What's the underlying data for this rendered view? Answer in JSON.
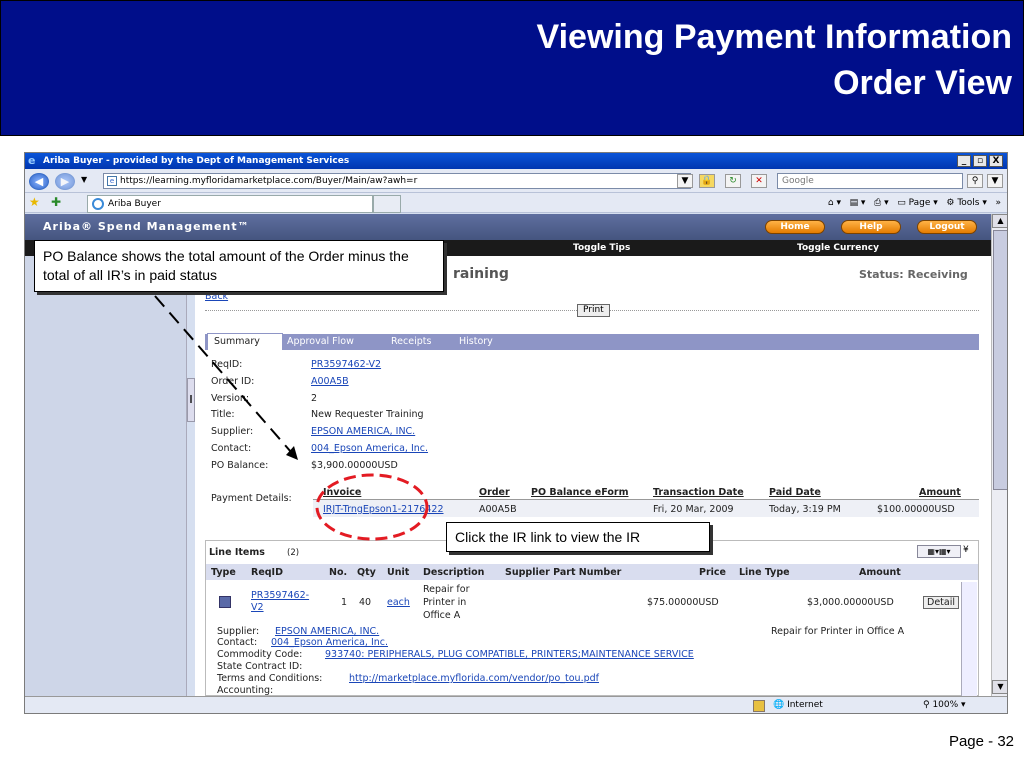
{
  "slide": {
    "title_line1": "Viewing Payment Information",
    "title_line2": "Order View",
    "page": "Page - 32"
  },
  "browser": {
    "window_title": "Ariba Buyer - provided by the Dept of Management Services",
    "window_min": "_",
    "window_max": "»",
    "window_close": "X",
    "url": "https://learning.myfloridamarketplace.com/Buyer/Main/aw?awh=r",
    "search_placeholder": "Google",
    "tab_title": "Ariba Buyer",
    "commands": {
      "page": "Page",
      "tools": "Tools"
    },
    "status_zone": "Internet",
    "zoom": "100%"
  },
  "ariba": {
    "brand": "Ariba® Spend Management™",
    "home": "Home",
    "help": "Help",
    "logout": "Logout",
    "toggle_tips": "Toggle Tips",
    "toggle_currency": "Toggle Currency",
    "page_title_fragment": "raining",
    "status": "Status: Receiving",
    "back": "Back",
    "print": "Print",
    "tabs": [
      "Summary",
      "Approval Flow",
      "Receipts",
      "History"
    ],
    "details": [
      {
        "label": "ReqID:",
        "value": "PR3597462-V2",
        "link": true
      },
      {
        "label": "Order ID:",
        "value": "A00A5B",
        "link": true
      },
      {
        "label": "Version:",
        "value": "2",
        "link": false
      },
      {
        "label": "Title:",
        "value": "New Requester Training",
        "link": false
      },
      {
        "label": "Supplier:",
        "value": "EPSON AMERICA, INC.",
        "link": true
      },
      {
        "label": "Contact:",
        "value": "004_Epson America, Inc.",
        "link": true
      },
      {
        "label": "PO Balance:",
        "value": "$3,900.00000USD",
        "link": false
      }
    ],
    "payment": {
      "label": "Payment Details:",
      "headers": [
        "Invoice",
        "Order",
        "PO Balance eForm",
        "Transaction Date",
        "Paid Date",
        "Amount"
      ],
      "row": [
        "IRJT-TrngEpson1-2176422",
        "A00A5B",
        "",
        "Fri, 20 Mar, 2009",
        "Today, 3:19 PM",
        "$100.00000USD"
      ]
    },
    "line_items": {
      "title": "Line Items",
      "count": "(2)",
      "headers": [
        "Type",
        "ReqID",
        "No.",
        "Qty",
        "Unit",
        "Description",
        "Supplier Part Number",
        "Price",
        "Line Type",
        "Amount"
      ],
      "row": {
        "reqid_1": "PR3597462-",
        "reqid_2": "V2",
        "no": "1",
        "qty": "40",
        "unit": "each",
        "desc_1": "Repair for",
        "desc_2": "Printer in",
        "desc_3": "Office A",
        "price": "$75.00000USD",
        "amount": "$3,000.00000USD",
        "detail": "Detail"
      },
      "extra": {
        "supplier_label": "Supplier:",
        "supplier": "EPSON AMERICA, INC.",
        "contact_label": "Contact:",
        "contact": "004_Epson America, Inc.",
        "commodity_label": "Commodity Code:",
        "commodity": "933740: PERIPHERALS, PLUG COMPATIBLE, PRINTERS;MAINTENANCE SERVICE",
        "state_label": "State Contract ID:",
        "terms_label": "Terms and Conditions:",
        "terms": "http://marketplace.myflorida.com/vendor/po_tou.pdf",
        "accounting_label": "Accounting:",
        "note": "Repair for Printer in Office A"
      }
    }
  },
  "callouts": {
    "po_balance": "PO Balance shows the total amount of the Order minus the total of all IR’s in paid status",
    "ir_link": "Click the IR link to view the IR"
  },
  "colors": {
    "slide_header": "#000e8a",
    "callout_circle": "#e31b23",
    "ariba_link": "#1a46b8"
  }
}
